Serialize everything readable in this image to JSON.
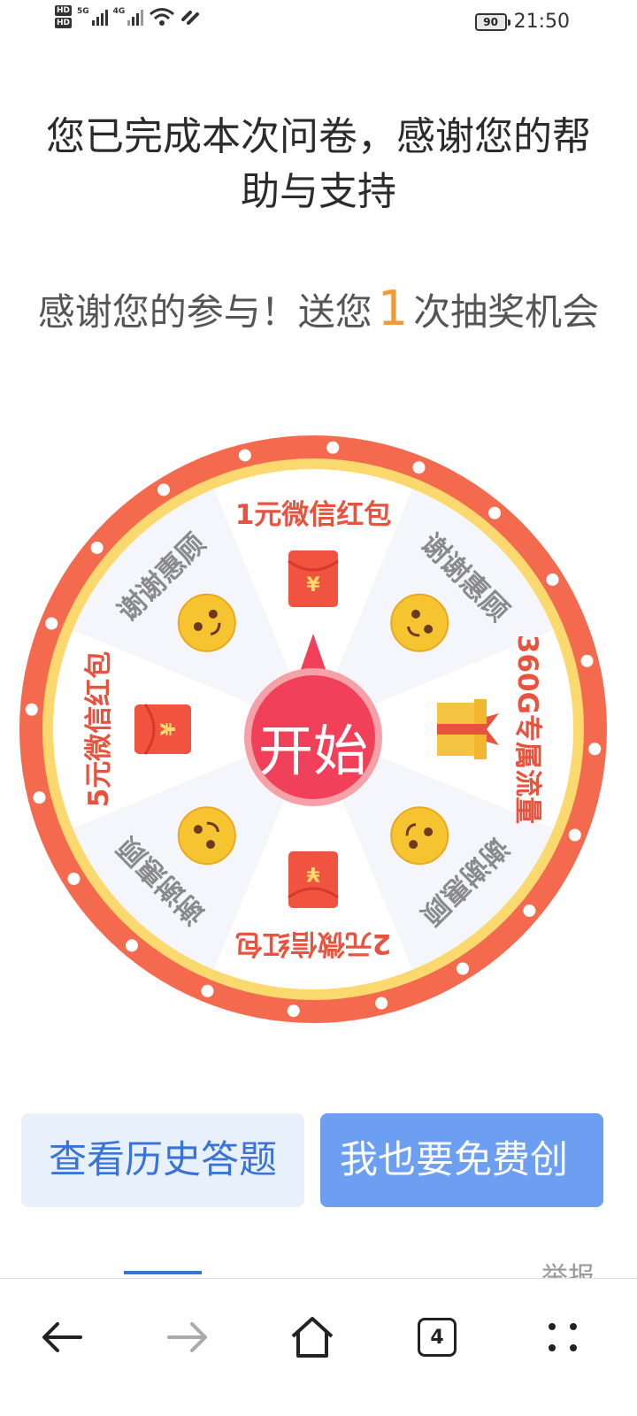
{
  "status_bar": {
    "sim1": "HD",
    "sim2": "HD",
    "net1": "5G",
    "net2": "4G",
    "battery": "90",
    "time": "21:50"
  },
  "title": "您已完成本次问卷，感谢您的帮助与支持",
  "subtitle": {
    "before": "感谢您的参与！送您",
    "count": "1",
    "after": "次抽奖机会"
  },
  "wheel": {
    "start_label": "开始",
    "prizes": [
      {
        "label": "1元微信红包",
        "icon": "red-envelope-icon"
      },
      {
        "label": "谢谢惠顾",
        "icon": "smiley-icon"
      },
      {
        "label": "360G专属流量",
        "icon": "gift-box-icon"
      },
      {
        "label": "谢谢惠顾",
        "icon": "smiley-icon"
      },
      {
        "label": "2元微信红包",
        "icon": "red-envelope-icon"
      },
      {
        "label": "谢谢惠顾",
        "icon": "smiley-icon"
      },
      {
        "label": "5元微信红包",
        "icon": "red-envelope-icon"
      },
      {
        "label": "谢谢惠顾",
        "icon": "smiley-icon"
      }
    ],
    "colors": {
      "rim": "#f46a4e",
      "inner_rim": "#fbd96e",
      "slice_light": "#f4f6fb",
      "slice_white": "#ffffff",
      "prize_text": "#e8533f",
      "thanks_text": "#8a8a8a",
      "button": "#f0405a"
    }
  },
  "buttons": {
    "history": "查看历史答题",
    "create": "我也要免费创"
  },
  "report": "举报",
  "bottom_nav": {
    "tabs_count": "4",
    "icons": [
      "back-arrow-icon",
      "forward-arrow-icon",
      "home-icon",
      "tabs-icon",
      "more-icon"
    ]
  }
}
